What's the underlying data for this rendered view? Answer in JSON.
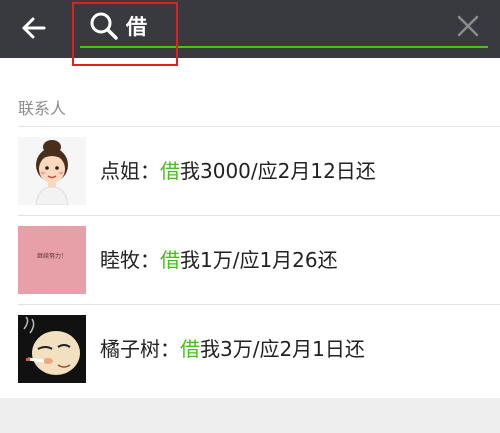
{
  "search": {
    "query": "借"
  },
  "section": {
    "title": "联系人"
  },
  "contacts": [
    {
      "name": "点姐",
      "sep": "：",
      "match": "借",
      "rest": "我3000/应2月12日还"
    },
    {
      "name": "睦牧",
      "sep": "：",
      "match": "借",
      "rest": "我1万/应1月26还",
      "avatar_caption": "继续努力！"
    },
    {
      "name": "橘子树",
      "sep": "：",
      "match": "借",
      "rest": "我3万/应2月1日还"
    }
  ],
  "colors": {
    "topbar": "#393a3f",
    "accent_green": "#46c01b",
    "highlight_red": "#e02020",
    "section_gray": "#8e8e8e"
  },
  "icons": [
    "back-arrow-icon",
    "search-icon",
    "clear-icon"
  ]
}
